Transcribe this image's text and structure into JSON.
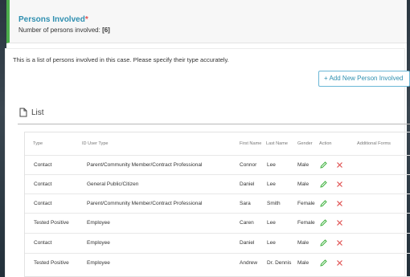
{
  "header": {
    "title": "Persons Involved",
    "required_mark": "*",
    "count_label": "Number of persons involved:",
    "count_value": "[6]"
  },
  "intro_text": "This is a list of persons involved in this case. Please specify their type accurately.",
  "add_button_label": "+ Add New Person Involved",
  "list_title": "List",
  "columns": {
    "type": "Type",
    "id_user_type": "ID User Type",
    "first_name": "First Name",
    "last_name": "Last Name",
    "gender": "Gender",
    "action": "Action",
    "additional_forms": "Additional Forms"
  },
  "rows": [
    {
      "type": "Contact",
      "user_type": "Parent/Community Member/Contract Professional",
      "first_name": "Connor",
      "last_name": "Lee",
      "gender": "Male"
    },
    {
      "type": "Contact",
      "user_type": "General Public/Citizen",
      "first_name": "Daniel",
      "last_name": "Lee",
      "gender": "Male"
    },
    {
      "type": "Contact",
      "user_type": "Parent/Community Member/Contract Professional",
      "first_name": "Sara",
      "last_name": "Smith",
      "gender": "Female"
    },
    {
      "type": "Tested Positive",
      "user_type": "Employee",
      "first_name": "Caren",
      "last_name": "Lee",
      "gender": "Female"
    },
    {
      "type": "Contact",
      "user_type": "Employee",
      "first_name": "Daniel",
      "last_name": "Lee",
      "gender": "Male"
    },
    {
      "type": "Tested Positive",
      "user_type": "Employee",
      "first_name": "Andrew",
      "last_name": "Dr. Dennis",
      "gender": "Male"
    }
  ],
  "colors": {
    "accent": "#2f8fb0",
    "header_bar": "#4cae4c",
    "edit_icon": "#3db03d",
    "delete_icon": "#e05050"
  },
  "icons": {
    "edit": "pencil-icon",
    "delete": "close-icon",
    "list": "document-icon"
  }
}
